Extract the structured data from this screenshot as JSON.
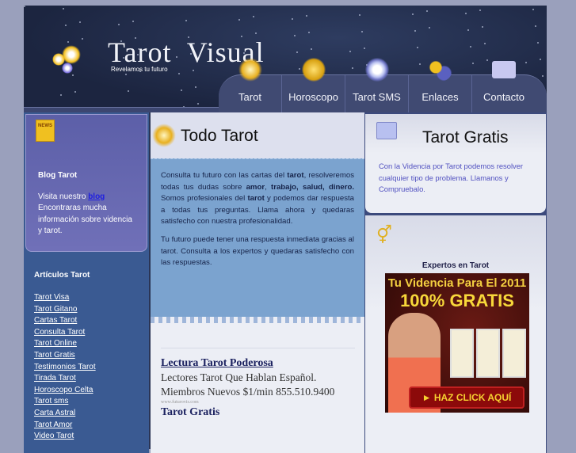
{
  "header": {
    "logo_title": "Tarot  Visual",
    "logo_tagline": "Revelamos tu futuro"
  },
  "nav": [
    {
      "label": "Tarot",
      "icon": "stars-icon"
    },
    {
      "label": "Horoscopo",
      "icon": "moon-coin-icon"
    },
    {
      "label": "Tarot SMS",
      "icon": "zodiac-wheel-icon"
    },
    {
      "label": "Enlaces",
      "icon": "planets-icon"
    },
    {
      "label": "Contacto",
      "icon": "envelope-icon"
    }
  ],
  "left": {
    "blog": {
      "badge": "NEWS",
      "title": "Blog Tarot",
      "text_before": "Visita nuestro ",
      "link": "blog",
      "text_after": "Encontraras mucha información sobre videncia y tarot."
    },
    "articles_title": "Artículos Tarot",
    "articles": [
      "Tarot Visa",
      "Tarot Gitano",
      "Cartas Tarot",
      "Consulta Tarot",
      "Tarot Online",
      "Tarot Gratis",
      "Testimonios Tarot",
      "Tirada Tarot",
      "Horoscopo Celta",
      "Tarot sms",
      "Carta Astral",
      "Tarot Amor",
      "Video Tarot"
    ]
  },
  "main": {
    "title": "Todo Tarot",
    "p1": {
      "a": "Consulta tu futuro con las cartas del ",
      "b1": "tarot",
      "c": ", resolveremos todas tus dudas sobre ",
      "b2": "amor",
      "d": ", ",
      "b3": "trabajo, salud, dinero.",
      "e": " Somos profesionales del ",
      "b4": "tarot",
      "f": " y podemos dar respuesta a todas tus preguntas. Llama ahora y quedaras satisfecho con nuestra profesionalidad."
    },
    "p2": "Tu futuro puede tener una respuesta inmediata gracias al tarot. Consulta a los expertos y quedaras satisfecho con las respuestas.",
    "ads": [
      {
        "title": "Lectura Tarot Poderosa",
        "text": "Lectores Tarot Que Hablan Español. Miembros Nuevos $1/min 855.510.9400",
        "url": "www.futurovis.com"
      },
      {
        "title": "Tarot Gratis"
      }
    ]
  },
  "right": {
    "box1": {
      "title": "Tarot Gratis",
      "text": "Con la Videncia por Tarot podemos resolver cualquier tipo de problema. Llamanos y Compruebalo."
    },
    "box2": {
      "title": "Expertos en Tarot",
      "banner": {
        "line1": "Tu Videncia Para El 2011",
        "line2": "100% GRATIS",
        "cta": "► HAZ CLICK AQUÍ"
      }
    }
  }
}
